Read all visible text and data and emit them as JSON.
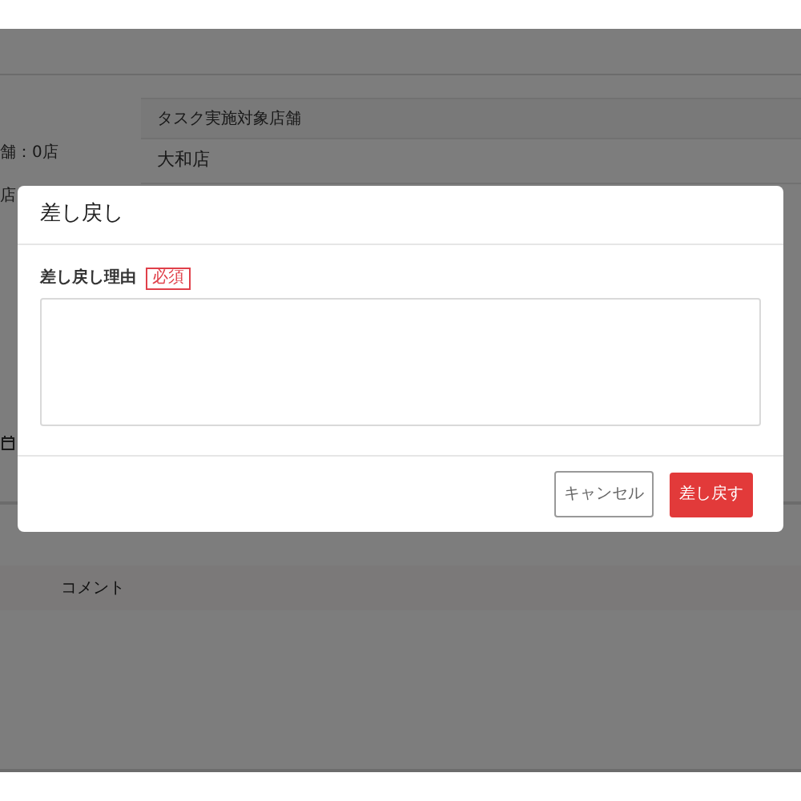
{
  "background": {
    "store_count": "舗：0店",
    "store_cut": "店",
    "store_header": "タスク実施対象店舗",
    "store_name": "大和店",
    "comment_header": "コメント"
  },
  "dialog": {
    "title": "差し戻し",
    "field_label": "差し戻し理由",
    "required_badge": "必須",
    "buttons": [
      {
        "label": "キャンセル",
        "kind": "secondary"
      },
      {
        "label": "差し戻す",
        "kind": "primary"
      }
    ]
  }
}
